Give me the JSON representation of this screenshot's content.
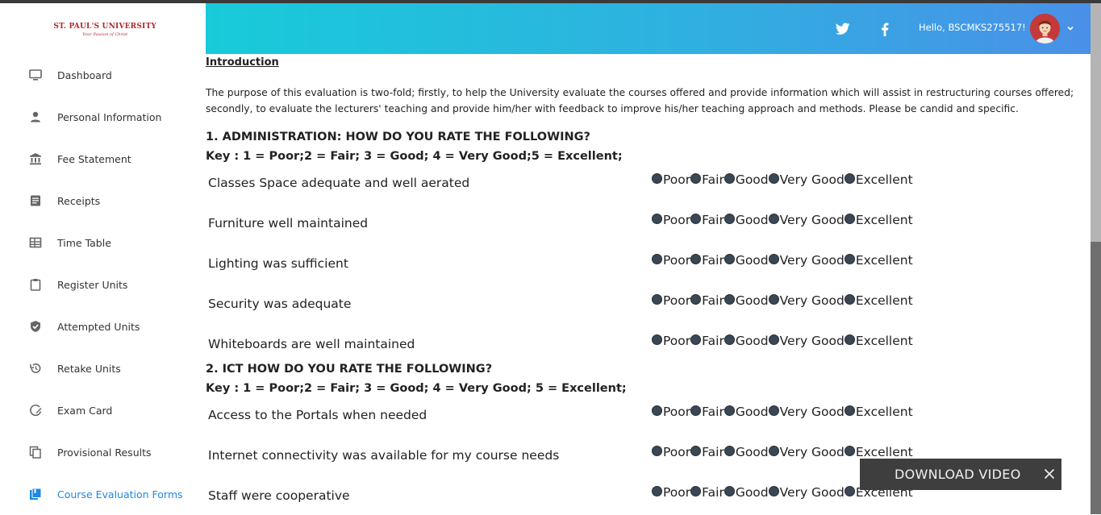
{
  "logo": {
    "name": "ST. PAUL'S UNIVERSITY",
    "motto": "Your Passion of Christ"
  },
  "sidebar": {
    "items": [
      {
        "label": "Dashboard",
        "icon": "monitor-icon"
      },
      {
        "label": "Personal Information",
        "icon": "person-icon"
      },
      {
        "label": "Fee Statement",
        "icon": "bank-icon"
      },
      {
        "label": "Receipts",
        "icon": "receipt-icon"
      },
      {
        "label": "Time Table",
        "icon": "table-icon"
      },
      {
        "label": "Register Units",
        "icon": "clipboard-icon"
      },
      {
        "label": "Attempted Units",
        "icon": "shield-check-icon"
      },
      {
        "label": "Retake Units",
        "icon": "history-icon"
      },
      {
        "label": "Exam Card",
        "icon": "edit-card-icon"
      },
      {
        "label": "Provisional Results",
        "icon": "copy-icon"
      },
      {
        "label": "Course Evaluation Forms",
        "icon": "book-icon",
        "active": true
      }
    ]
  },
  "header": {
    "greeting": "Hello, BSCMKS275517!"
  },
  "intro": {
    "title": "Introduction",
    "body": "The purpose of this evaluation is two-fold; firstly, to help the University evaluate the courses offered and provide information which will assist in restructuring courses offered; secondly, to evaluate the lecturers' teaching and provide him/her with feedback to improve his/her teaching approach and methods. Please be candid and specific."
  },
  "options": [
    "Poor",
    "Fair",
    "Good",
    "Very Good",
    "Excellent"
  ],
  "sections": [
    {
      "title": "1. ADMINISTRATION: HOW DO YOU RATE THE FOLLOWING?",
      "key": "Key : 1 = Poor;2 = Fair; 3 = Good; 4 = Very Good;5 = Excellent;",
      "questions": [
        "Classes Space adequate and well aerated",
        "Furniture well maintained",
        "Lighting was sufficient",
        "Security was adequate",
        "Whiteboards are well maintained"
      ]
    },
    {
      "title": "2. ICT HOW DO YOU RATE THE FOLLOWING?",
      "key": "Key : 1 = Poor;2 = Fair; 3 = Good; 4 = Very Good; 5 = Excellent;",
      "questions": [
        "Access to the Portals when needed",
        "Internet connectivity was available for my course needs",
        "Staff were cooperative"
      ]
    }
  ],
  "toast": {
    "label": "DOWNLOAD VIDEO"
  }
}
